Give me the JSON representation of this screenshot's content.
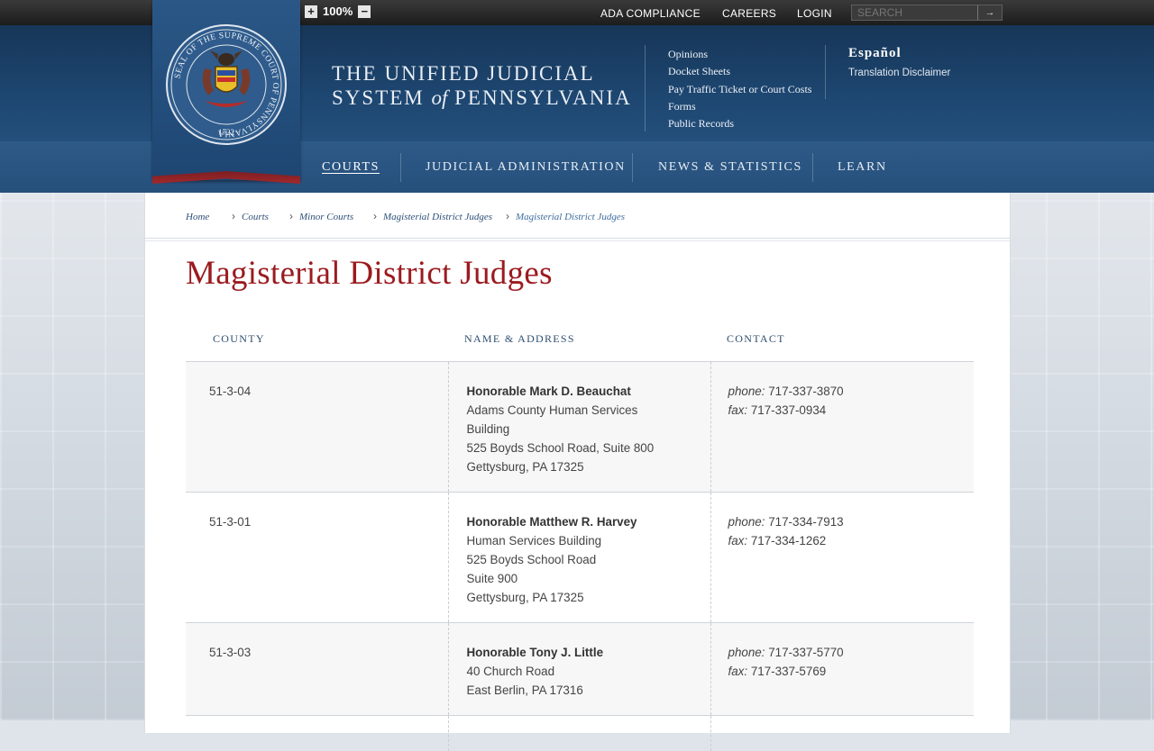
{
  "topbar": {
    "zoom_in": "+",
    "zoom_level": "100%",
    "zoom_out": "−",
    "links": [
      "ADA COMPLIANCE",
      "CAREERS",
      "LOGIN"
    ],
    "search_placeholder": "SEARCH",
    "search_go": "→"
  },
  "header": {
    "seal_inscription_top": "SEAL OF THE SUPREME COURT OF PENNSYLVANIA",
    "seal_year": "1722",
    "title_line1": "THE UNIFIED JUDICIAL",
    "title_line2_a": "SYSTEM",
    "title_line2_of": "of",
    "title_line2_b": "PENNSYLVANIA",
    "quick_links": [
      "Opinions",
      "Docket Sheets",
      "Pay Traffic Ticket or Court Costs",
      "Forms",
      "Public Records"
    ],
    "language": "Español",
    "translation_disclaimer": "Translation Disclaimer"
  },
  "nav": {
    "items": [
      "COURTS",
      "JUDICIAL ADMINISTRATION",
      "NEWS & STATISTICS",
      "LEARN"
    ],
    "active": "COURTS"
  },
  "breadcrumb": [
    "Home",
    "Courts",
    "Minor Courts",
    "Magisterial District Judges",
    "Magisterial District Judges"
  ],
  "page_title": "Magisterial District Judges",
  "table": {
    "headers": [
      "COUNTY",
      "NAME & ADDRESS",
      "CONTACT"
    ],
    "phone_label": "phone:",
    "fax_label": "fax:",
    "rows": [
      {
        "county": "51-3-04",
        "name": "Honorable Mark D. Beauchat",
        "address": [
          "Adams County Human Services",
          "Building",
          "525 Boyds School Road, Suite 800",
          "Gettysburg, PA 17325"
        ],
        "phone": "717-337-3870",
        "fax": "717-337-0934"
      },
      {
        "county": "51-3-01",
        "name": "Honorable Matthew R. Harvey",
        "address": [
          "Human Services Building",
          "525 Boyds School Road",
          "Suite 900",
          "Gettysburg, PA 17325"
        ],
        "phone": "717-334-7913",
        "fax": "717-334-1262"
      },
      {
        "county": "51-3-03",
        "name": "Honorable Tony J. Little",
        "address": [
          "40 Church Road",
          "East Berlin, PA 17316"
        ],
        "phone": "717-337-5770",
        "fax": "717-337-5769"
      }
    ]
  },
  "colors": {
    "header_blue": "#1d4670",
    "nav_blue": "#2e5a88",
    "title_red": "#9b1b1f",
    "link_blue": "#2d4f78"
  }
}
